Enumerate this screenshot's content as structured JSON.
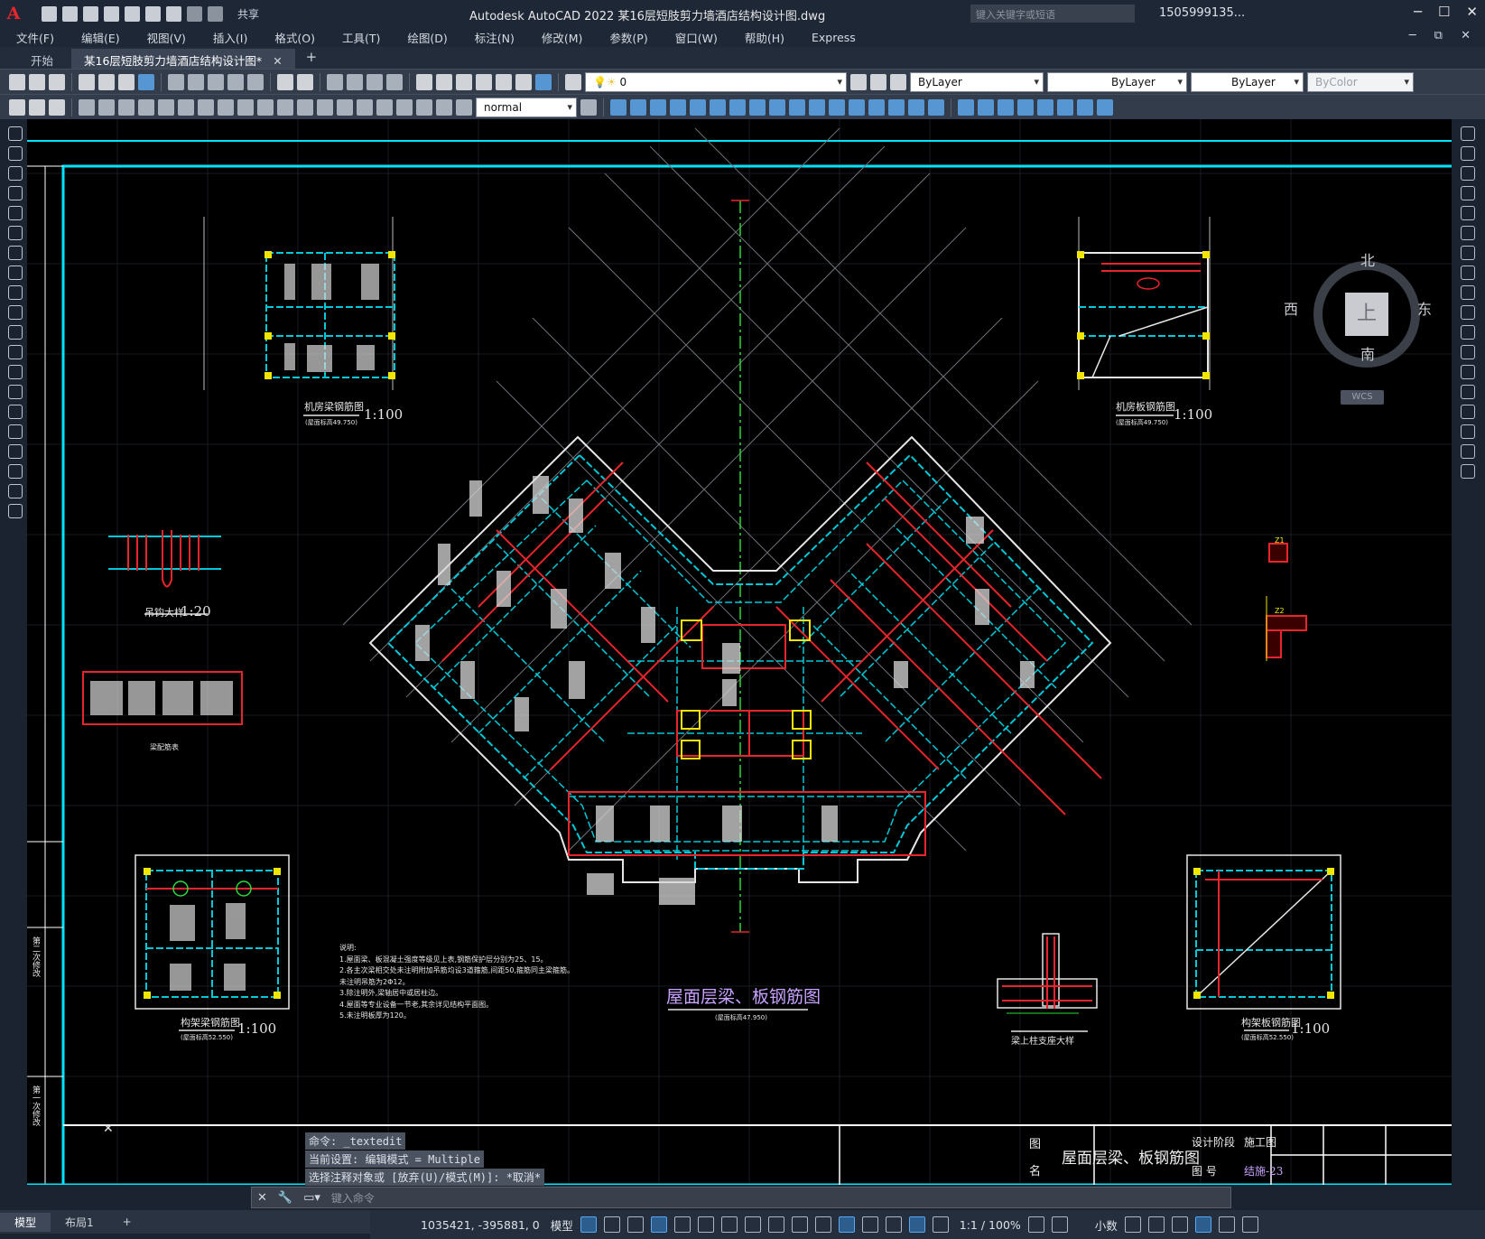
{
  "app": {
    "logo": "A",
    "title": "Autodesk AutoCAD 2022    某16层短肢剪力墙酒店结构设计图.dwg",
    "share_label": "共享",
    "search_placeholder": "键入关键字或短语",
    "user": "1505999135...",
    "colors": {
      "accent": "#00e5ff",
      "drawing_bg": "#000000"
    }
  },
  "menu": [
    "文件(F)",
    "编辑(E)",
    "视图(V)",
    "插入(I)",
    "格式(O)",
    "工具(T)",
    "绘图(D)",
    "标注(N)",
    "修改(M)",
    "参数(P)",
    "窗口(W)",
    "帮助(H)",
    "Express"
  ],
  "tabs": [
    {
      "label": "开始",
      "active": false
    },
    {
      "label": "某16层短肢剪力墙酒店结构设计图*",
      "active": true
    }
  ],
  "toolbar": {
    "layer_value": "0",
    "color": "ByLayer",
    "linetype": "ByLayer",
    "lineweight": "ByLayer",
    "plotstyle": "ByColor",
    "textstyle": "normal"
  },
  "viewcube": {
    "north": "北",
    "south": "南",
    "west": "西",
    "east": "东",
    "face": "上",
    "wcs": "WCS"
  },
  "drawing": {
    "main_title": "屋面层梁、板钢筋图",
    "main_subtitle": "(屋面标高47.950)",
    "detail_top_left": {
      "title": "机房梁钢筋图",
      "scale": "1:100",
      "sub": "(屋面标高49.750)"
    },
    "detail_top_right": {
      "title": "机房板钢筋图",
      "scale": "1:100",
      "sub": "(屋面标高49.750)"
    },
    "detail_bottom_left": {
      "title": "构架梁钢筋图",
      "scale": "1:100",
      "sub": "(屋面标高52.550)"
    },
    "detail_bottom_right": {
      "title": "构架板钢筋图",
      "scale": "1:100",
      "sub": "(屋面标高52.550)"
    },
    "hook_detail": {
      "title": "吊钩大样",
      "scale": "1:20"
    },
    "beam_column_detail": "梁上柱支座大样",
    "legend_label": "梁配筋表",
    "notes_title": "说明:",
    "notes": [
      "1.屋面梁、板混凝土强度等级见上表,钢筋保护层分别为25、15。",
      "2.各主次梁相交处未注明附加吊筋均设3道箍筋,间距50,箍筋同主梁箍筋。",
      "未注明吊筋为2Φ12。",
      "3.除注明外,梁轴居中或居柱边。",
      "4.屋面等专业设备一节老,其余详见结构平面图。",
      "5.未注明板厚为120。"
    ],
    "column_labels": [
      "Z1",
      "Z2"
    ],
    "title_block": {
      "name_label_1": "图",
      "name_label_2": "名",
      "drawing_name": "屋面层梁、板钢筋图",
      "phase_label": "设计阶段",
      "phase_value": "施工图",
      "number_label": "图  号",
      "number_value": "结施-23"
    },
    "revision_labels": [
      "第二次修改",
      "第一次修改"
    ]
  },
  "command": {
    "history": [
      "命令: _textedit",
      "当前设置: 编辑模式 = Multiple",
      "选择注释对象或 [放弃(U)/模式(M)]: *取消*"
    ],
    "placeholder": "键入命令"
  },
  "layout_tabs": [
    {
      "label": "模型",
      "active": true
    },
    {
      "label": "布局1",
      "active": false
    }
  ],
  "status": {
    "coords": "1035421, -395881, 0",
    "space": "模型",
    "annotation_scale": "1:1 / 100%",
    "units": "小数"
  }
}
